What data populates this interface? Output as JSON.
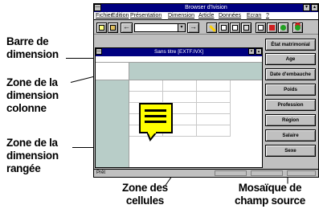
{
  "callouts": {
    "dimension_bar": "Barre de\ndimension",
    "column_zone": "Zone de la\ndimension\ncolonne",
    "row_zone": "Zone de la\ndimension\nrangée",
    "cell_zone": "Zone des\ncellules",
    "field_tiles": "Mosaïque de\nchamp source"
  },
  "app": {
    "title": "Browser d'Ivision",
    "minimize_label": "▾",
    "maximize_label": "▴",
    "menu": [
      "Fichier",
      "Edition",
      "Présentation",
      "Dimension",
      "Article",
      "Données",
      "Ecran",
      "?"
    ],
    "document_title": "Sans titre [EXTF.IVX]"
  },
  "toolbar": {
    "prev_arrow": "←",
    "next_arrow": "→",
    "combo_value": ""
  },
  "fields": [
    "État matrimonial",
    "Age",
    "Date d'embauche",
    "Poids",
    "Profession",
    "Région",
    "Salaire",
    "Sexe"
  ],
  "status": {
    "text": "Prêt"
  },
  "colors": {
    "titlebar": "#000080",
    "window_face": "#c0c0c0",
    "header_zone": "#b8cdc8",
    "note": "#ffff00"
  }
}
